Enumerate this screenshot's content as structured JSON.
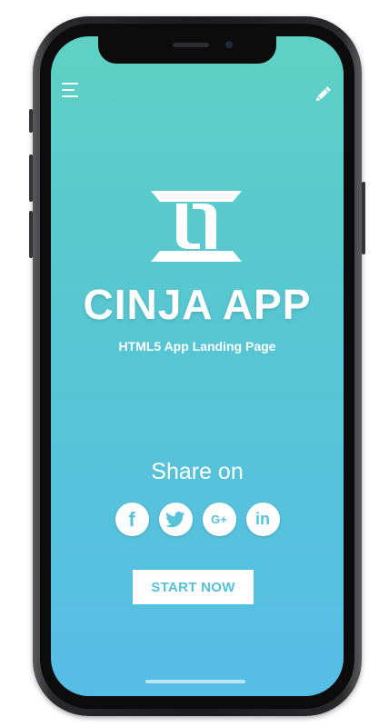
{
  "app": {
    "title": "CINJA APP",
    "subtitle": "HTML5 App Landing Page"
  },
  "header": {
    "menu_icon": "menu-icon",
    "edit_icon": "pencil-icon"
  },
  "share": {
    "label": "Share on",
    "networks": [
      {
        "name": "facebook",
        "glyph": "f"
      },
      {
        "name": "twitter",
        "glyph": "twitter-bird"
      },
      {
        "name": "google-plus",
        "glyph": "G+"
      },
      {
        "name": "linkedin",
        "glyph": "in"
      }
    ]
  },
  "cta": {
    "label": "START NOW"
  },
  "colors": {
    "gradient_top": "#5ed1c4",
    "gradient_bottom": "#56bde6",
    "accent": "#54c1d9",
    "phone_frame": "#1b1b1d"
  }
}
